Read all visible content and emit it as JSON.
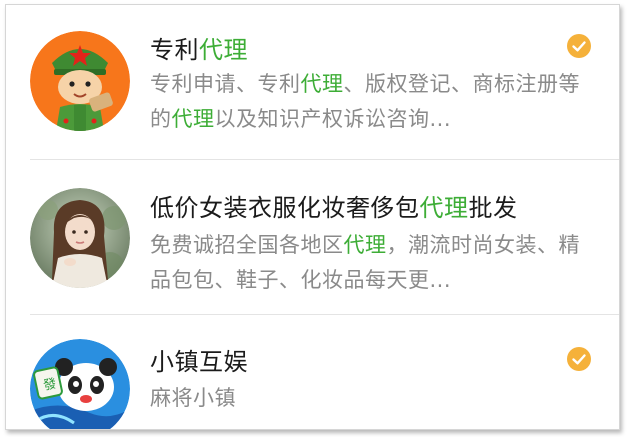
{
  "results": [
    {
      "title_parts": [
        "专利",
        "代理"
      ],
      "desc_parts": [
        "专利申请、专利",
        "代理",
        "、版权登记、商标注册等的",
        "代理",
        "以及知识产权诉讼咨询..."
      ],
      "verified": true,
      "avatar": "soldier-cartoon-avatar"
    },
    {
      "title_parts": [
        "低价女装衣服化妆奢侈包",
        "代理",
        "批发"
      ],
      "desc_parts": [
        "免费诚招全国各地区",
        "代理",
        "，潮流时尚女装、精品包包、鞋子、化妆品每天更..."
      ],
      "verified": false,
      "avatar": "woman-photo-avatar"
    },
    {
      "title_parts": [
        "小镇互娱"
      ],
      "desc_parts": [
        "麻将小镇"
      ],
      "verified": true,
      "avatar": "panda-mahjong-avatar"
    }
  ],
  "colors": {
    "highlight": "#3dad36",
    "badge": "#f5b13a",
    "title": "#1b1b1b",
    "description": "#8a8a8a"
  },
  "icons": {
    "verified_badge": "check-icon"
  }
}
